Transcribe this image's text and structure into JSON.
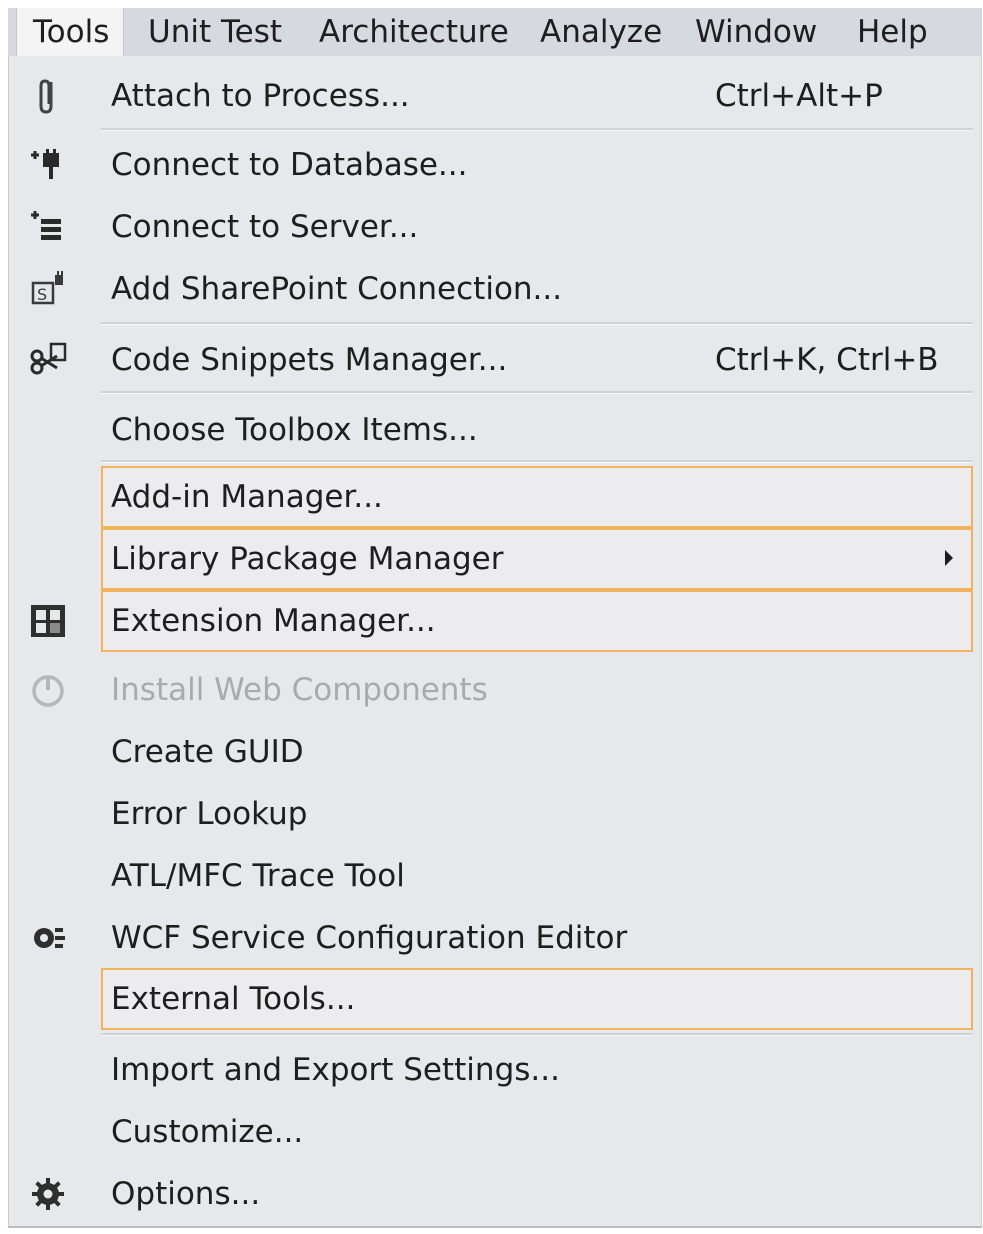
{
  "menubar": {
    "items": [
      "Tools",
      "Unit Test",
      "Architecture",
      "Analyze",
      "Window",
      "Help"
    ]
  },
  "menu": {
    "attach": {
      "label": "Attach to Process...",
      "shortcut": "Ctrl+Alt+P",
      "icon": "paperclip-icon"
    },
    "connect_db": {
      "label": "Connect to Database...",
      "icon": "database-plug-icon"
    },
    "connect_server": {
      "label": "Connect to Server...",
      "icon": "server-add-icon"
    },
    "sharepoint": {
      "label": "Add SharePoint Connection...",
      "icon": "sharepoint-icon"
    },
    "snippets": {
      "label": "Code Snippets Manager...",
      "shortcut": "Ctrl+K, Ctrl+B",
      "icon": "snippet-icon"
    },
    "toolbox": {
      "label": "Choose Toolbox Items..."
    },
    "addin": {
      "label": "Add-in Manager..."
    },
    "library": {
      "label": "Library Package Manager"
    },
    "extension": {
      "label": "Extension Manager...",
      "icon": "extension-icon"
    },
    "web_components": {
      "label": "Install Web Components",
      "icon": "power-icon"
    },
    "guid": {
      "label": "Create GUID"
    },
    "error_lookup": {
      "label": "Error Lookup"
    },
    "atl_trace": {
      "label": "ATL/MFC Trace Tool"
    },
    "wcf": {
      "label": "WCF Service Configuration Editor",
      "icon": "wcf-gear-icon"
    },
    "external_tools": {
      "label": "External Tools..."
    },
    "import_export": {
      "label": "Import and Export Settings..."
    },
    "customize": {
      "label": "Customize..."
    },
    "options": {
      "label": "Options...",
      "icon": "gear-icon"
    }
  },
  "colors": {
    "menu_bg": "#e7e8ec",
    "menubar_bg": "#d6d9df",
    "highlight_border": "#f2b35c",
    "disabled_text": "#a8aaae"
  }
}
